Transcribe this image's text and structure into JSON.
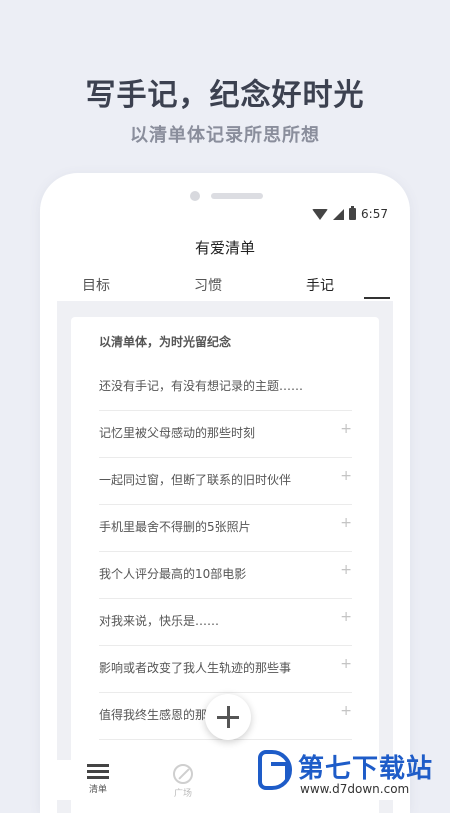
{
  "promo": {
    "title": "写手记，纪念好时光",
    "subtitle": "以清单体记录所思所想"
  },
  "status_bar": {
    "time": "6:57",
    "icons": [
      "wifi-icon",
      "signal-icon",
      "battery-icon"
    ]
  },
  "app": {
    "title": "有爱清单",
    "tabs": [
      {
        "label": "目标",
        "active": false
      },
      {
        "label": "习惯",
        "active": false
      },
      {
        "label": "手记",
        "active": true
      }
    ]
  },
  "card": {
    "header": "以清单体，为时光留纪念",
    "items": [
      {
        "text": "还没有手记，有没有想记录的主题……",
        "plus": ""
      },
      {
        "text": "记忆里被父母感动的那些时刻",
        "plus": "+"
      },
      {
        "text": "一起同过窗，但断了联系的旧时伙伴",
        "plus": "+"
      },
      {
        "text": "手机里最舍不得删的5张照片",
        "plus": "+"
      },
      {
        "text": "我个人评分最高的10部电影",
        "plus": "+"
      },
      {
        "text": "对我来说，快乐是……",
        "plus": "+"
      },
      {
        "text": "影响或者改变了我人生轨迹的那些事",
        "plus": "+"
      },
      {
        "text": "值得我终生感恩的那些人",
        "plus": "+"
      }
    ]
  },
  "fab": {
    "icon": "plus-icon"
  },
  "bottom_nav": [
    {
      "label": "清单",
      "icon": "list-icon",
      "active": true
    },
    {
      "label": "广场",
      "icon": "compass-icon",
      "active": false
    }
  ],
  "watermark": {
    "title": "第七下载站",
    "url": "www.d7down.com"
  },
  "colors": {
    "background": "#eceef5",
    "promo_title": "#3c4150",
    "promo_subtitle": "#8a8e9c",
    "watermark_blue": "#1e5cc8"
  }
}
